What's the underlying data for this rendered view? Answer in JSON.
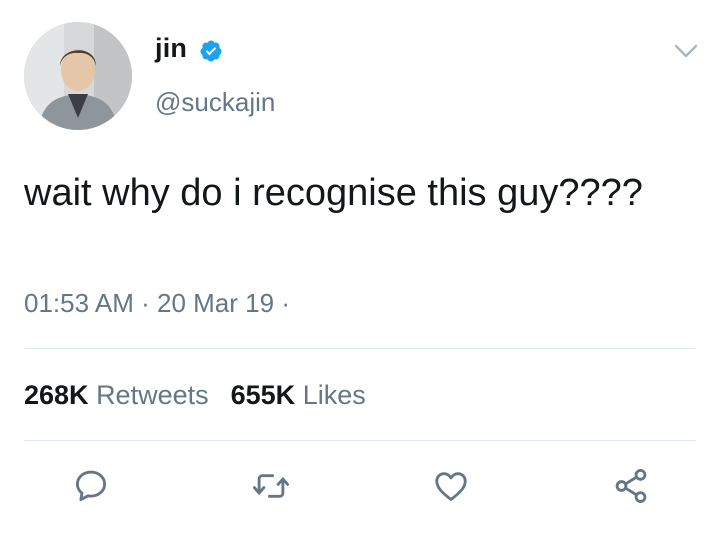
{
  "author": {
    "name": "jin",
    "handle": "@suckajin",
    "verified": true,
    "avatar_icon": "profile-photo"
  },
  "tweet": {
    "text": "wait why do i recognise this guy????",
    "time": "01:53 AM",
    "date": "20 Mar 19",
    "meta_separator": "·"
  },
  "stats": {
    "retweets_count": "268K",
    "retweets_label": "Retweets",
    "likes_count": "655K",
    "likes_label": "Likes"
  },
  "actions": [
    {
      "icon": "reply-icon"
    },
    {
      "icon": "retweet-icon"
    },
    {
      "icon": "like-icon"
    },
    {
      "icon": "share-icon"
    }
  ],
  "colors": {
    "text": "#14171a",
    "secondary": "#657786",
    "verified_blue": "#1da1f2",
    "divider": "#e1e8ed"
  }
}
